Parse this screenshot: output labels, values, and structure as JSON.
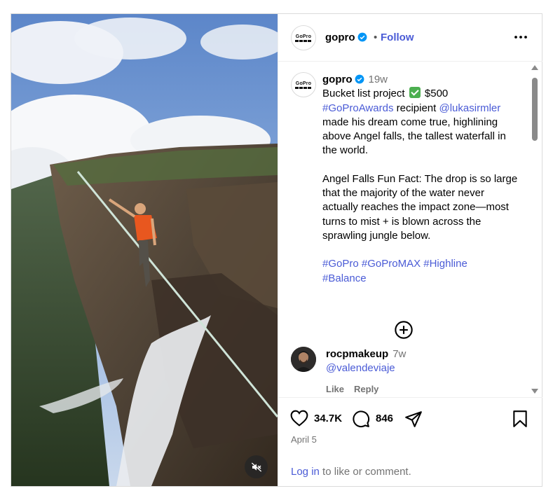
{
  "post": {
    "username": "gopro",
    "follow_label": "Follow",
    "dot": "•",
    "avatar_logo": "GoPro"
  },
  "caption": {
    "username": "gopro",
    "time": "19w",
    "line1_before": "Bucket list project ",
    "line1_after": " $500",
    "hashtag_awards": "#GoProAwards",
    "recipient": " recipient ",
    "mention": "@lukasirmler",
    "line2": " made his dream come true, highlining above Angel falls, the tallest waterfall in the world.",
    "fun_fact": "Angel Falls Fun Fact: The drop is so large that the majority of the water never actually reaches the impact zone—most turns to mist + is blown across the sprawling jungle below.",
    "hashtags": [
      "#GoPro",
      "#GoProMAX",
      "#Highline",
      "#Balance"
    ]
  },
  "comment": {
    "username": "rocpmakeup",
    "time": "7w",
    "text": "@valendeviaje",
    "like_label": "Like",
    "reply_label": "Reply"
  },
  "stats": {
    "likes": "34.7K",
    "comments": "846",
    "date": "April 5"
  },
  "footer": {
    "login_link": "Log in",
    "login_rest": " to like or comment."
  },
  "icons": {
    "verified": "verified-badge-icon",
    "more": "more-options-icon",
    "load_more": "plus-circle-icon",
    "like": "heart-icon",
    "comment": "comment-bubble-icon",
    "share": "paper-plane-icon",
    "save": "bookmark-icon",
    "mute": "muted-speaker-icon"
  },
  "colors": {
    "link": "#4a5bd6",
    "verified": "#0095f6",
    "secondary_text": "#737373",
    "check": "#4caf50"
  }
}
